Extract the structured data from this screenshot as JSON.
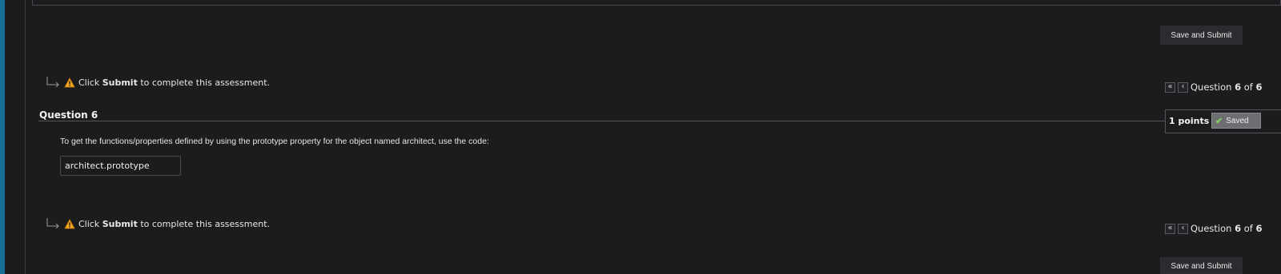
{
  "toolbar": {
    "save_submit_label": "Save and Submit"
  },
  "hint": {
    "prefix": "Click",
    "action": "Submit",
    "suffix": "to complete this assessment."
  },
  "nav": {
    "label": "Question",
    "current": "6",
    "of": "of",
    "total": "6"
  },
  "question": {
    "title": "Question 6",
    "points": "1 points",
    "status": "Saved",
    "text": "To get the functions/properties defined by using the prototype property for the object named architect, use the code:",
    "answer": "architect.prototype"
  },
  "colors": {
    "accent_bar": "#1a6f9a",
    "background": "#1b1c1e",
    "saved_check": "#7fd35a",
    "warning": "#f5a623"
  },
  "icons": {
    "warning": "warning-icon",
    "elbow": "elbow-arrow-icon",
    "first": "double-chevron-left-icon",
    "prev": "chevron-left-icon",
    "check": "check-icon"
  }
}
